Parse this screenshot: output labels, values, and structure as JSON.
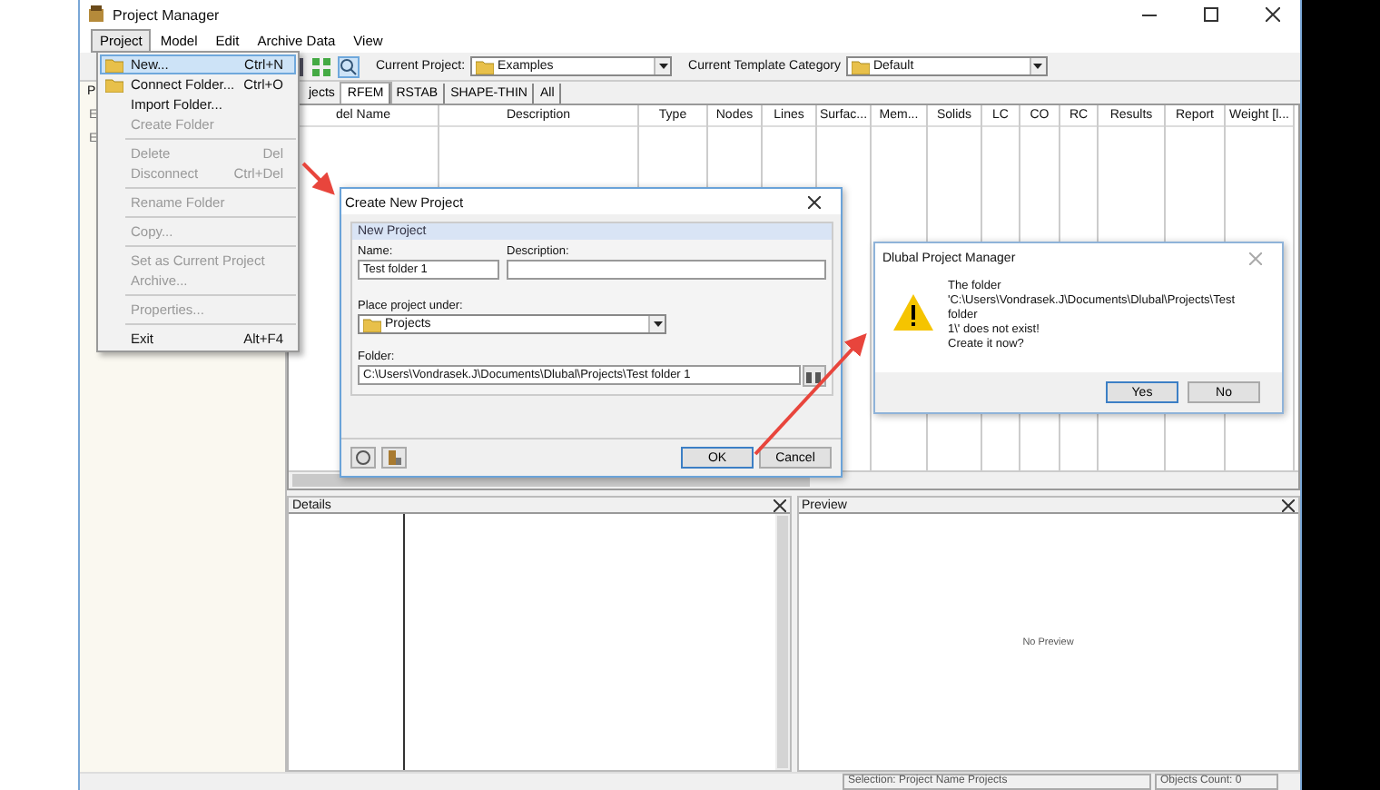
{
  "window": {
    "title": "Project Manager"
  },
  "menubar": [
    {
      "label": "Project",
      "selected": true
    },
    {
      "label": "Model",
      "selected": false
    },
    {
      "label": "Edit",
      "selected": false
    },
    {
      "label": "Archive Data",
      "selected": false
    },
    {
      "label": "View",
      "selected": false
    }
  ],
  "toolbar": {
    "project_label": "Current Project:",
    "project": "Examples",
    "template_label": "Current Template Category",
    "template": "Default"
  },
  "left_panel": {
    "tab": "P",
    "items": [
      "E",
      "E"
    ]
  },
  "model_tabs": [
    {
      "label": "jects",
      "selected": false
    },
    {
      "label": "RFEM",
      "selected": true
    },
    {
      "label": "RSTAB",
      "selected": false
    },
    {
      "label": "SHAPE-THIN",
      "selected": false
    },
    {
      "label": "All",
      "selected": false
    }
  ],
  "table": {
    "columns": [
      "del Name",
      "Description",
      "Type",
      "Nodes",
      "Lines",
      "Surfac...",
      "Mem...",
      "Solids",
      "LC",
      "CO",
      "RC",
      "Results",
      "Report",
      "Weight [l..."
    ]
  },
  "details": {
    "title": "Details"
  },
  "preview": {
    "title": "Preview",
    "message": "No Preview"
  },
  "status_bar": [
    "Selection: Project Name Projects",
    "Objects Count: 0"
  ],
  "project_menu": [
    {
      "kind": "item",
      "label": "New...",
      "shortcut": "Ctrl+N",
      "disabled": false,
      "selected": true
    },
    {
      "kind": "item",
      "label": "Connect Folder...",
      "shortcut": "Ctrl+O",
      "disabled": false,
      "selected": false
    },
    {
      "kind": "item",
      "label": "Import Folder...",
      "disabled": false,
      "selected": false
    },
    {
      "kind": "item",
      "label": "Create Folder",
      "disabled": true,
      "selected": false
    },
    {
      "kind": "separator"
    },
    {
      "kind": "item",
      "label": "Delete",
      "shortcut": "Del",
      "disabled": true,
      "selected": false
    },
    {
      "kind": "item",
      "label": "Disconnect",
      "shortcut": "Ctrl+Del",
      "disabled": true,
      "selected": false
    },
    {
      "kind": "separator"
    },
    {
      "kind": "item",
      "label": "Rename Folder",
      "disabled": true,
      "selected": false
    },
    {
      "kind": "separator"
    },
    {
      "kind": "item",
      "label": "Copy...",
      "disabled": true,
      "selected": false
    },
    {
      "kind": "separator"
    },
    {
      "kind": "item",
      "label": "Set as Current Project",
      "disabled": true,
      "selected": false
    },
    {
      "kind": "item",
      "label": "Archive...",
      "disabled": true,
      "selected": false
    },
    {
      "kind": "separator"
    },
    {
      "kind": "item",
      "label": "Properties...",
      "disabled": true,
      "selected": false
    },
    {
      "kind": "separator"
    },
    {
      "kind": "item",
      "label": "Exit",
      "shortcut": "Alt+F4",
      "disabled": false,
      "selected": false
    }
  ],
  "create_dialog": {
    "title": "Create New Project",
    "section": "New Project",
    "name_label": "Name:",
    "name_value": "Test folder 1",
    "description_label": "Description:",
    "parent_label": "Place project under:",
    "parent_value": "Projects",
    "folder_label": "Folder:",
    "folder_value": "C:\\Users\\Vondrasek.J\\Documents\\Dlubal\\Projects\\Test folder 1",
    "buttons": [
      {
        "label": "OK",
        "default": true
      },
      {
        "label": "Cancel",
        "default": false
      }
    ]
  },
  "message_box": {
    "title": "Dlubal Project Manager",
    "message": "The folder\n'C:\\Users\\Vondrasek.J\\Documents\\Dlubal\\Projects\\Test folder\n1\\' does not exist!\nCreate it now?",
    "buttons": [
      {
        "label": "Yes",
        "default": true
      },
      {
        "label": "No",
        "default": false
      }
    ]
  }
}
